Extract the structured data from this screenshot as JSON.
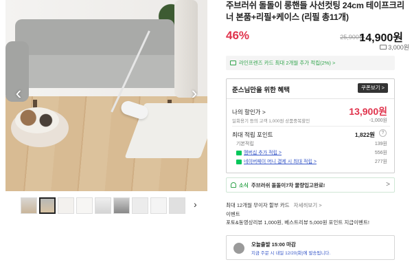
{
  "gallery": {
    "thumbnail_count": 9
  },
  "product": {
    "title": "주브러쉬 돌돌이 롱핸들 사선컷팅 24cm 테이프크리너 본품+리필+케이스 (리필 총11개)",
    "discount": "46%",
    "original_price": "25,900원",
    "sale_price": "14,900원",
    "shipping_fee": "3,000원"
  },
  "card_banner": {
    "text": "라인프렌즈 카드 최대 2개월 추가 적립(2%) >"
  },
  "benefits": {
    "heading": "준스님만을 위한 혜택",
    "coupon_button": "쿠폰보기 >",
    "my_price_label": "나의 할인가 >",
    "my_price": "13,900원",
    "my_price_note": "일회용기 등의 고객 1,000원 상품중복할인",
    "my_price_discount": "-1,000원",
    "points_label": "최대 적립 포인트",
    "points_value": "1,822원",
    "points_help": "?",
    "points_rows": [
      {
        "label": "기본적립",
        "value": "139원",
        "link": false
      },
      {
        "label": "멤버십 추가 적립 >",
        "value": "556원",
        "link": true
      },
      {
        "label": "네이버페이 머니 결제 시 최대 적립 >",
        "value": "277원",
        "link": true
      }
    ]
  },
  "news": {
    "tag": "소식",
    "message": "주브러쉬 돌돌이7차 물량입고완료!",
    "chevron": ">"
  },
  "installment": {
    "text": "최대 12개월 무이자 할부 카드",
    "more": "자세히보기 >"
  },
  "event": {
    "title": "이벤트",
    "text": "포토&동영상리뷰 1,000원, 베스트리뷰 5,000원 포인트 지급이벤트!"
  },
  "delivery": {
    "line1": "오늘출발 15:00 마감",
    "line2": "지금 주문 시 내일 12/20(화)에 발송됩니다."
  },
  "colors": {
    "accent_red": "#e0334c",
    "naver_green": "#2fa34a",
    "link_blue": "#3455c7"
  }
}
